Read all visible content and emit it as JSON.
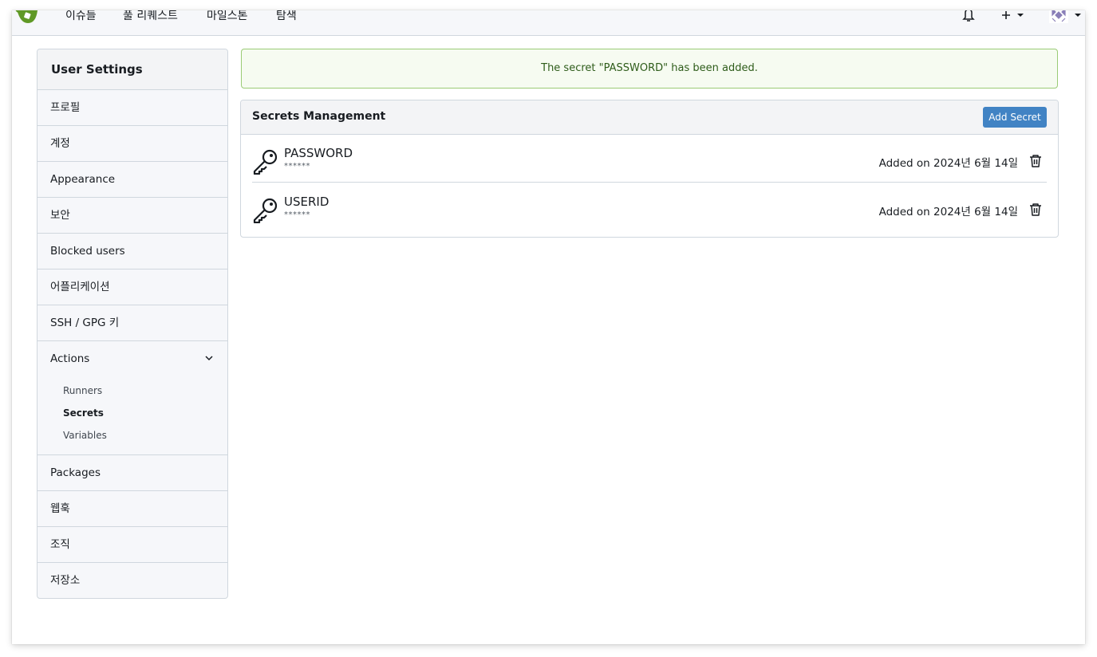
{
  "nav": {
    "items": [
      "이슈들",
      "풀 리퀘스트",
      "마일스톤",
      "탐색"
    ]
  },
  "sidebar": {
    "title": "User Settings",
    "items": [
      {
        "label": "프로필"
      },
      {
        "label": "계정"
      },
      {
        "label": "Appearance"
      },
      {
        "label": "보안"
      },
      {
        "label": "Blocked users"
      },
      {
        "label": "어플리케이션"
      },
      {
        "label": "SSH / GPG 키"
      },
      {
        "label": "Actions",
        "expanded": true,
        "children": [
          "Runners",
          "Secrets",
          "Variables"
        ],
        "active_child": "Secrets"
      },
      {
        "label": "Packages"
      },
      {
        "label": "웹훅"
      },
      {
        "label": "조직"
      },
      {
        "label": "저장소"
      }
    ]
  },
  "flash": {
    "message": "The secret \"PASSWORD\" has been added.",
    "color": "#9acb75"
  },
  "secrets": {
    "title": "Secrets Management",
    "add_label": "Add Secret",
    "accent": "#4183c4",
    "items": [
      {
        "name": "PASSWORD",
        "mask": "******",
        "date": "Added on 2024년 6월 14일"
      },
      {
        "name": "USERID",
        "mask": "******",
        "date": "Added on 2024년 6월 14일"
      }
    ]
  }
}
